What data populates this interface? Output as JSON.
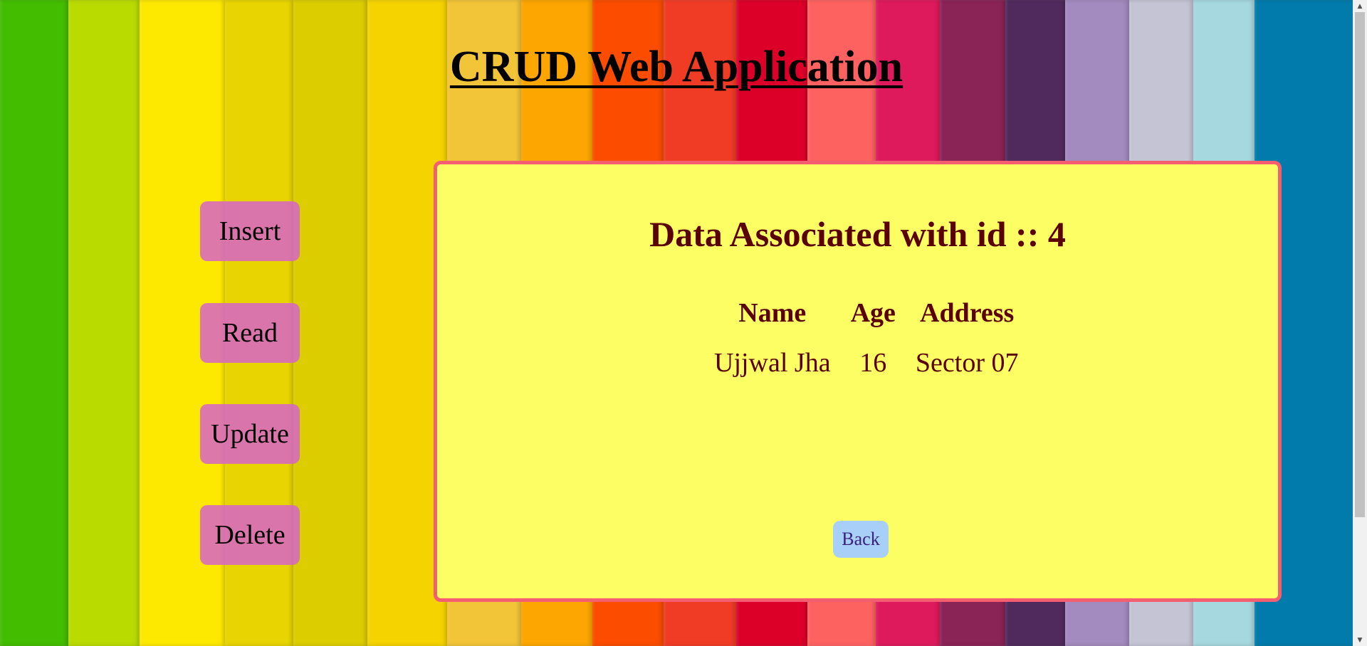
{
  "app": {
    "title": "CRUD Web Application"
  },
  "nav": {
    "items": [
      {
        "label": "Insert"
      },
      {
        "label": "Read"
      },
      {
        "label": "Update"
      },
      {
        "label": "Delete"
      }
    ]
  },
  "panel": {
    "heading": "Data Associated with id :: 4",
    "table": {
      "headers": [
        "Name",
        "Age",
        "Address"
      ],
      "rows": [
        [
          "Ujjwal Jha",
          "16",
          "Sector 07"
        ]
      ]
    },
    "back_label": "Back"
  },
  "colors": {
    "panel_bg": "#fdfe64",
    "panel_border": "#f45e70",
    "text_accent": "#5a0000",
    "nav_button": "#d664c8",
    "back_button": "#a8cff8",
    "background_stripes": [
      "#43bd00",
      "#b9db00",
      "#fde800",
      "#e8d400",
      "#dccd00",
      "#f5d300",
      "#f2c437",
      "#fda500",
      "#fb4c00",
      "#f03b25",
      "#dc0028",
      "#fe6260",
      "#de1a5c",
      "#8a2356",
      "#512a5d",
      "#a38abf",
      "#c5c4d4",
      "#a6d8e0",
      "#007bab"
    ]
  }
}
